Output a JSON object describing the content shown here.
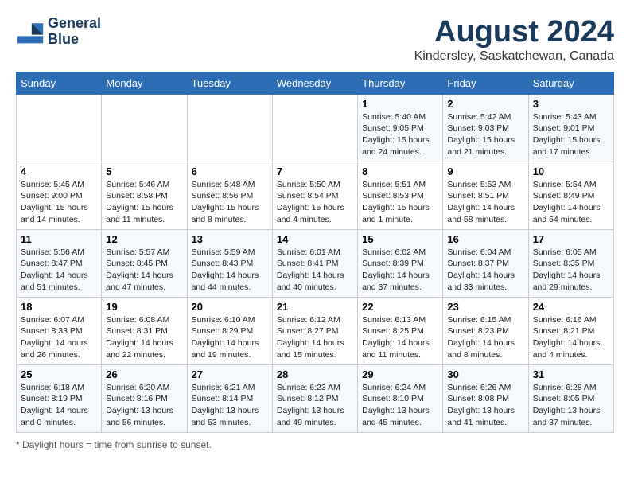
{
  "header": {
    "logo_line1": "General",
    "logo_line2": "Blue",
    "month": "August 2024",
    "location": "Kindersley, Saskatchewan, Canada"
  },
  "days_of_week": [
    "Sunday",
    "Monday",
    "Tuesday",
    "Wednesday",
    "Thursday",
    "Friday",
    "Saturday"
  ],
  "footer": {
    "note": "Daylight hours"
  },
  "weeks": [
    [
      {
        "day": "",
        "info": ""
      },
      {
        "day": "",
        "info": ""
      },
      {
        "day": "",
        "info": ""
      },
      {
        "day": "",
        "info": ""
      },
      {
        "day": "1",
        "info": "Sunrise: 5:40 AM\nSunset: 9:05 PM\nDaylight: 15 hours\nand 24 minutes."
      },
      {
        "day": "2",
        "info": "Sunrise: 5:42 AM\nSunset: 9:03 PM\nDaylight: 15 hours\nand 21 minutes."
      },
      {
        "day": "3",
        "info": "Sunrise: 5:43 AM\nSunset: 9:01 PM\nDaylight: 15 hours\nand 17 minutes."
      }
    ],
    [
      {
        "day": "4",
        "info": "Sunrise: 5:45 AM\nSunset: 9:00 PM\nDaylight: 15 hours\nand 14 minutes."
      },
      {
        "day": "5",
        "info": "Sunrise: 5:46 AM\nSunset: 8:58 PM\nDaylight: 15 hours\nand 11 minutes."
      },
      {
        "day": "6",
        "info": "Sunrise: 5:48 AM\nSunset: 8:56 PM\nDaylight: 15 hours\nand 8 minutes."
      },
      {
        "day": "7",
        "info": "Sunrise: 5:50 AM\nSunset: 8:54 PM\nDaylight: 15 hours\nand 4 minutes."
      },
      {
        "day": "8",
        "info": "Sunrise: 5:51 AM\nSunset: 8:53 PM\nDaylight: 15 hours\nand 1 minute."
      },
      {
        "day": "9",
        "info": "Sunrise: 5:53 AM\nSunset: 8:51 PM\nDaylight: 14 hours\nand 58 minutes."
      },
      {
        "day": "10",
        "info": "Sunrise: 5:54 AM\nSunset: 8:49 PM\nDaylight: 14 hours\nand 54 minutes."
      }
    ],
    [
      {
        "day": "11",
        "info": "Sunrise: 5:56 AM\nSunset: 8:47 PM\nDaylight: 14 hours\nand 51 minutes."
      },
      {
        "day": "12",
        "info": "Sunrise: 5:57 AM\nSunset: 8:45 PM\nDaylight: 14 hours\nand 47 minutes."
      },
      {
        "day": "13",
        "info": "Sunrise: 5:59 AM\nSunset: 8:43 PM\nDaylight: 14 hours\nand 44 minutes."
      },
      {
        "day": "14",
        "info": "Sunrise: 6:01 AM\nSunset: 8:41 PM\nDaylight: 14 hours\nand 40 minutes."
      },
      {
        "day": "15",
        "info": "Sunrise: 6:02 AM\nSunset: 8:39 PM\nDaylight: 14 hours\nand 37 minutes."
      },
      {
        "day": "16",
        "info": "Sunrise: 6:04 AM\nSunset: 8:37 PM\nDaylight: 14 hours\nand 33 minutes."
      },
      {
        "day": "17",
        "info": "Sunrise: 6:05 AM\nSunset: 8:35 PM\nDaylight: 14 hours\nand 29 minutes."
      }
    ],
    [
      {
        "day": "18",
        "info": "Sunrise: 6:07 AM\nSunset: 8:33 PM\nDaylight: 14 hours\nand 26 minutes."
      },
      {
        "day": "19",
        "info": "Sunrise: 6:08 AM\nSunset: 8:31 PM\nDaylight: 14 hours\nand 22 minutes."
      },
      {
        "day": "20",
        "info": "Sunrise: 6:10 AM\nSunset: 8:29 PM\nDaylight: 14 hours\nand 19 minutes."
      },
      {
        "day": "21",
        "info": "Sunrise: 6:12 AM\nSunset: 8:27 PM\nDaylight: 14 hours\nand 15 minutes."
      },
      {
        "day": "22",
        "info": "Sunrise: 6:13 AM\nSunset: 8:25 PM\nDaylight: 14 hours\nand 11 minutes."
      },
      {
        "day": "23",
        "info": "Sunrise: 6:15 AM\nSunset: 8:23 PM\nDaylight: 14 hours\nand 8 minutes."
      },
      {
        "day": "24",
        "info": "Sunrise: 6:16 AM\nSunset: 8:21 PM\nDaylight: 14 hours\nand 4 minutes."
      }
    ],
    [
      {
        "day": "25",
        "info": "Sunrise: 6:18 AM\nSunset: 8:19 PM\nDaylight: 14 hours\nand 0 minutes."
      },
      {
        "day": "26",
        "info": "Sunrise: 6:20 AM\nSunset: 8:16 PM\nDaylight: 13 hours\nand 56 minutes."
      },
      {
        "day": "27",
        "info": "Sunrise: 6:21 AM\nSunset: 8:14 PM\nDaylight: 13 hours\nand 53 minutes."
      },
      {
        "day": "28",
        "info": "Sunrise: 6:23 AM\nSunset: 8:12 PM\nDaylight: 13 hours\nand 49 minutes."
      },
      {
        "day": "29",
        "info": "Sunrise: 6:24 AM\nSunset: 8:10 PM\nDaylight: 13 hours\nand 45 minutes."
      },
      {
        "day": "30",
        "info": "Sunrise: 6:26 AM\nSunset: 8:08 PM\nDaylight: 13 hours\nand 41 minutes."
      },
      {
        "day": "31",
        "info": "Sunrise: 6:28 AM\nSunset: 8:05 PM\nDaylight: 13 hours\nand 37 minutes."
      }
    ]
  ]
}
